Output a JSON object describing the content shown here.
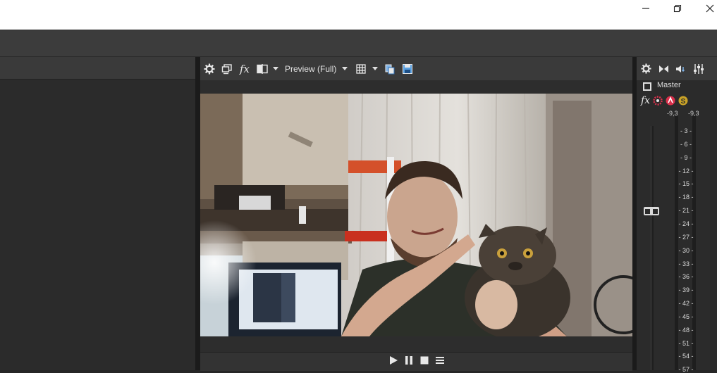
{
  "window": {
    "minimize_icon": "minimize-icon",
    "restore_icon": "restore-icon",
    "close_icon": "close-icon"
  },
  "preview": {
    "toolbar": {
      "settings_icon": "gear-icon",
      "external_monitor_icon": "monitor-icon",
      "fx_label": "fx",
      "split_icon": "split-screen-icon",
      "quality_label": "Preview (Full)",
      "grid_icon": "grid-icon",
      "copy_icon": "copy-snapshot-icon",
      "save_icon": "save-snapshot-icon"
    },
    "transport": {
      "play_icon": "play-icon",
      "pause_icon": "pause-icon",
      "stop_icon": "stop-icon",
      "menu_icon": "menu-icon"
    }
  },
  "mixer": {
    "toolbar": {
      "settings_icon": "gear-icon",
      "downmix_icon": "downmix-icon",
      "dim_icon": "speaker-icon",
      "mixer_icon": "sliders-icon"
    },
    "master_label": "Master",
    "fx_label": "fx",
    "peak_left": "-9,3",
    "peak_right": "-9,3",
    "scale": [
      "3",
      "6",
      "9",
      "12",
      "15",
      "18",
      "21",
      "24",
      "27",
      "30",
      "33",
      "36",
      "39",
      "42",
      "45",
      "48",
      "51",
      "54",
      "57"
    ],
    "fader_level": 0.33
  },
  "colors": {
    "panel_bg": "#2b2b2b",
    "toolbar_bg": "#3a3a3a",
    "titlebar_bg": "#ffffff",
    "accent_red": "#d9304b",
    "accent_gold": "#c9a227"
  }
}
